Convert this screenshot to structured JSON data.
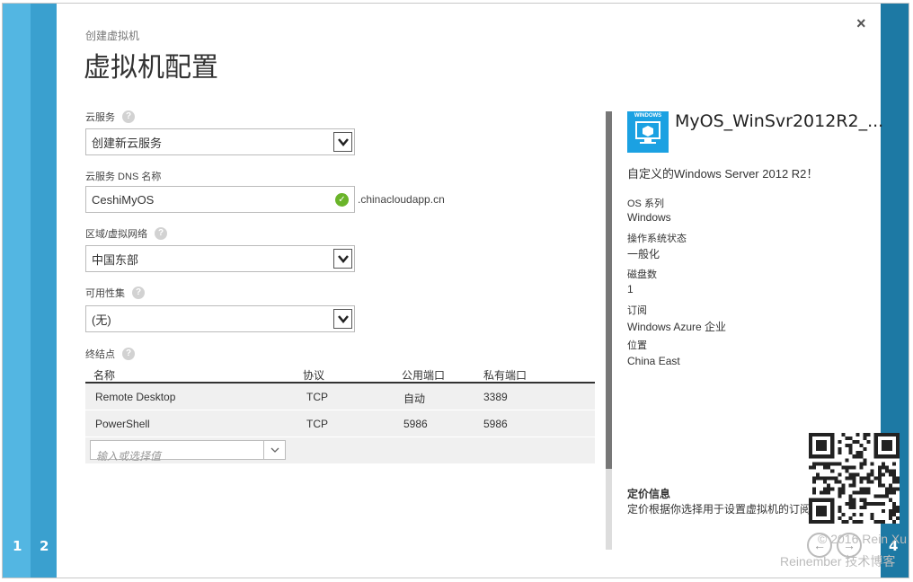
{
  "steps": {
    "step1": "1",
    "step2": "2",
    "step4": "4"
  },
  "header": {
    "breadcrumb": "创建虚拟机",
    "title": "虚拟机配置",
    "close": "×"
  },
  "form": {
    "cloud_service": {
      "label": "云服务",
      "value": "创建新云服务"
    },
    "dns_name": {
      "label": "云服务 DNS 名称",
      "value": "CeshiMyOS",
      "suffix": ".chinacloudapp.cn"
    },
    "region": {
      "label": "区域/虚拟网络",
      "value": "中国东部"
    },
    "availability_set": {
      "label": "可用性集",
      "value": "(无)"
    },
    "endpoints": {
      "label": "终结点",
      "headers": [
        "名称",
        "协议",
        "公用端口",
        "私有端口"
      ],
      "rows": [
        [
          "Remote Desktop",
          "TCP",
          "自动",
          "3389"
        ],
        [
          "PowerShell",
          "TCP",
          "5986",
          "5986"
        ]
      ],
      "input_placeholder": "输入或选择值"
    }
  },
  "image_info": {
    "logo_text": "WINDOWS",
    "name": "MyOS_WinSvr2012R2_...",
    "description": "自定义的Windows Server 2012 R2！",
    "fields": [
      {
        "label": "OS 系列",
        "value": "Windows"
      },
      {
        "label": "操作系统状态",
        "value": "一般化"
      },
      {
        "label": "磁盘数",
        "value": "1"
      },
      {
        "label": "订阅",
        "value": "Windows Azure 企业"
      },
      {
        "label": "位置",
        "value": "China East"
      }
    ],
    "pricing_title": "定价信息",
    "pricing_text": "定价根据你选择用于设置虚拟机的订阅而..."
  },
  "watermark": {
    "line1": "© 2016 Rein Xu",
    "line2": "Reinember 技术博客"
  },
  "icons": {
    "help": "?",
    "check": "✓",
    "back": "←",
    "next": "→"
  },
  "colors": {
    "step1": "#53b6e2",
    "step2": "#3aa0cf",
    "step4": "#1d79a4",
    "logo": "#1ba1e2",
    "check": "#6ab42a"
  }
}
